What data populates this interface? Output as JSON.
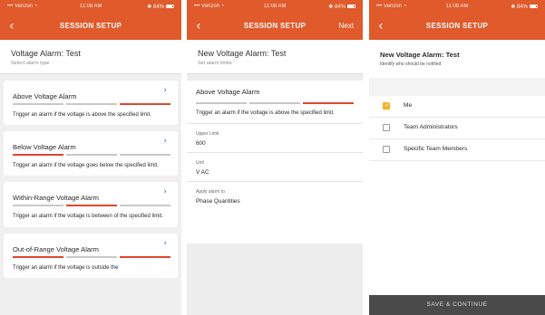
{
  "colors": {
    "brand_orange": "#e05a2b",
    "active_segment": "#e0472b",
    "inactive_segment": "#c8c8c8",
    "link_blue": "#1f6fd0",
    "checkbox_checked": "#f2b12a",
    "bottom_button": "#4a4a4a"
  },
  "status_bar": {
    "carrier": "Verizon",
    "time": "11:08 AM",
    "battery": "84%"
  },
  "screen1": {
    "nav": {
      "back_icon": "chevron-left-icon",
      "title": "SESSION SETUP"
    },
    "header": {
      "title": "Voltage Alarm: Test",
      "subtitle": "Select alarm type"
    },
    "alarms": [
      {
        "title": "Above Voltage Alarm",
        "active_segment": 3,
        "description": "Trigger an alarm if the voltage is above the specified limit."
      },
      {
        "title": "Below Voltage Alarm",
        "active_segment": 1,
        "description": "Trigger an alarm if the voltage goes below the specified limit."
      },
      {
        "title": "Within-Range Voltage Alarm",
        "active_segment": 2,
        "description": "Trigger an alarm if the voltage is between of the specified limit."
      },
      {
        "title": "Out-of-Range Voltage Alarm",
        "active_segments": [
          1,
          3
        ],
        "description": "Trigger an alarm if the voltage is outside the"
      }
    ]
  },
  "screen2": {
    "nav": {
      "back_icon": "chevron-left-icon",
      "title": "SESSION SETUP",
      "action": "Next"
    },
    "header": {
      "title": "New Voltage Alarm: Test",
      "subtitle": "Set alarm limits"
    },
    "alarm": {
      "title": "Above Voltage Alarm",
      "active_segment": 3,
      "description": "Trigger an alarm if the voltage is above the specified limit."
    },
    "fields": [
      {
        "label": "Upper Limit",
        "value": "600"
      },
      {
        "label": "Unit",
        "value": "V AC"
      },
      {
        "label": "Apply alarm to",
        "value": "Phase Quantities"
      }
    ]
  },
  "screen3": {
    "nav": {
      "back_icon": "chevron-left-icon",
      "title": "SESSION SETUP"
    },
    "header": {
      "title": "New Voltage Alarm: Test",
      "subtitle": "Identify who should be notified"
    },
    "options": [
      {
        "label": "Me",
        "checked": true
      },
      {
        "label": "Team Administrators",
        "checked": false
      },
      {
        "label": "Specific Team Members",
        "checked": false
      }
    ],
    "button": "SAVE & CONTINUE"
  }
}
